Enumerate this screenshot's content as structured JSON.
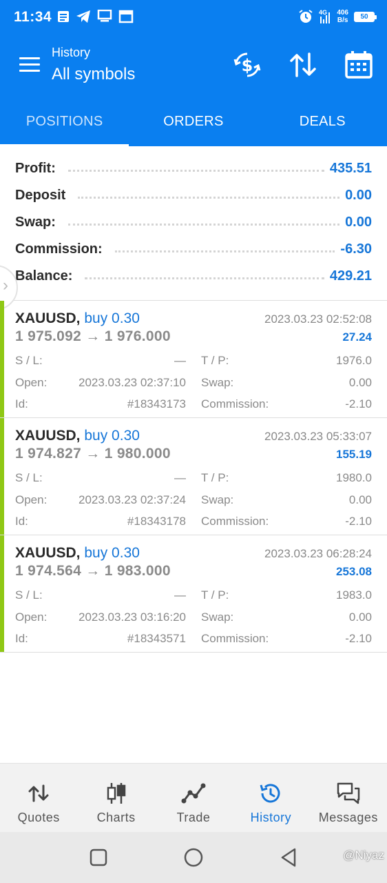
{
  "status_bar": {
    "time": "11:34",
    "net_speed_value": "406",
    "net_speed_unit": "B/s",
    "network": "4G",
    "battery": "50",
    "icons": [
      "message-icon",
      "telegram-icon",
      "desktop-icon",
      "calendar-icon",
      "alarm-icon",
      "signal-icon"
    ]
  },
  "toolbar": {
    "subtitle": "History",
    "title": "All symbols",
    "icons": [
      "menu-icon",
      "deposit-dollar-icon",
      "sort-icon",
      "calendar-icon"
    ]
  },
  "tabs": [
    {
      "label": "POSITIONS",
      "active": true
    },
    {
      "label": "ORDERS",
      "active": false
    },
    {
      "label": "DEALS",
      "active": false
    }
  ],
  "summary": {
    "profit": {
      "label": "Profit:",
      "value": "435.51"
    },
    "deposit": {
      "label": "Deposit",
      "value": "0.00"
    },
    "swap": {
      "label": "Swap:",
      "value": "0.00"
    },
    "commission": {
      "label": "Commission:",
      "value": "-6.30"
    },
    "balance": {
      "label": "Balance:",
      "value": "429.21"
    }
  },
  "positions": [
    {
      "symbol": "XAUUSD,",
      "direction": "buy 0.30",
      "close_time": "2023.03.23 02:52:08",
      "price_open": "1 975.092",
      "price_close": "1 976.000",
      "arrow": "→",
      "profit": "27.24",
      "sl_label": "S / L:",
      "sl": "—",
      "tp_label": "T / P:",
      "tp": "1976.0",
      "open_label": "Open:",
      "open": "2023.03.23 02:37:10",
      "swap_label": "Swap:",
      "swap": "0.00",
      "id_label": "Id:",
      "id": "#18343173",
      "commission_label": "Commission:",
      "commission": "-2.10"
    },
    {
      "symbol": "XAUUSD,",
      "direction": "buy 0.30",
      "close_time": "2023.03.23 05:33:07",
      "price_open": "1 974.827",
      "price_close": "1 980.000",
      "arrow": "→",
      "profit": "155.19",
      "sl_label": "S / L:",
      "sl": "—",
      "tp_label": "T / P:",
      "tp": "1980.0",
      "open_label": "Open:",
      "open": "2023.03.23 02:37:24",
      "swap_label": "Swap:",
      "swap": "0.00",
      "id_label": "Id:",
      "id": "#18343178",
      "commission_label": "Commission:",
      "commission": "-2.10"
    },
    {
      "symbol": "XAUUSD,",
      "direction": "buy 0.30",
      "close_time": "2023.03.23 06:28:24",
      "price_open": "1 974.564",
      "price_close": "1 983.000",
      "arrow": "→",
      "profit": "253.08",
      "sl_label": "S / L:",
      "sl": "—",
      "tp_label": "T / P:",
      "tp": "1983.0",
      "open_label": "Open:",
      "open": "2023.03.23 03:16:20",
      "swap_label": "Swap:",
      "swap": "0.00",
      "id_label": "Id:",
      "id": "#18343571",
      "commission_label": "Commission:",
      "commission": "-2.10"
    }
  ],
  "bottom_nav": [
    {
      "label": "Quotes",
      "icon": "quotes-arrows-icon",
      "active": false
    },
    {
      "label": "Charts",
      "icon": "candlestick-icon",
      "active": false
    },
    {
      "label": "Trade",
      "icon": "trade-line-icon",
      "active": false
    },
    {
      "label": "History",
      "icon": "history-clock-icon",
      "active": true
    },
    {
      "label": "Messages",
      "icon": "messages-chat-icon",
      "active": false
    }
  ],
  "system_nav": {
    "buttons": [
      "recents-square-icon",
      "home-circle-icon",
      "back-triangle-icon"
    ],
    "watermark": "@Niyaz"
  },
  "colors": {
    "primary": "#0a7ff0",
    "value_blue": "#1676d8",
    "buy_bar": "#8fc815",
    "muted": "#8a8a8a"
  }
}
